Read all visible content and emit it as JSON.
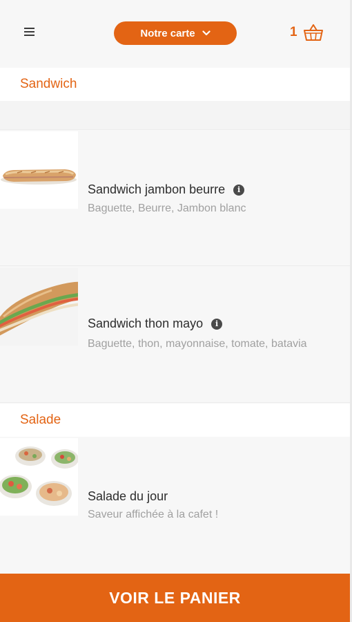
{
  "header": {
    "menu_icon": "hamburger-menu-icon",
    "category_button_label": "Notre carte",
    "cart_count": "1",
    "cart_icon": "basket-icon"
  },
  "sections": [
    {
      "title": "Sandwich",
      "items": [
        {
          "name": "Sandwich jambon beurre",
          "description": "Baguette, Beurre, Jambon blanc",
          "has_info": true
        },
        {
          "name": "Sandwich thon mayo",
          "description": "Baguette, thon, mayonnaise, tomate, batavia",
          "has_info": true
        }
      ]
    },
    {
      "title": "Salade",
      "items": [
        {
          "name": "Salade du jour",
          "description": "Saveur affichée à la cafet !",
          "has_info": false
        }
      ]
    }
  ],
  "footer": {
    "cart_button_label": "VOIR LE PANIER"
  },
  "colors": {
    "accent": "#e36414",
    "background": "#f7f7f7"
  }
}
